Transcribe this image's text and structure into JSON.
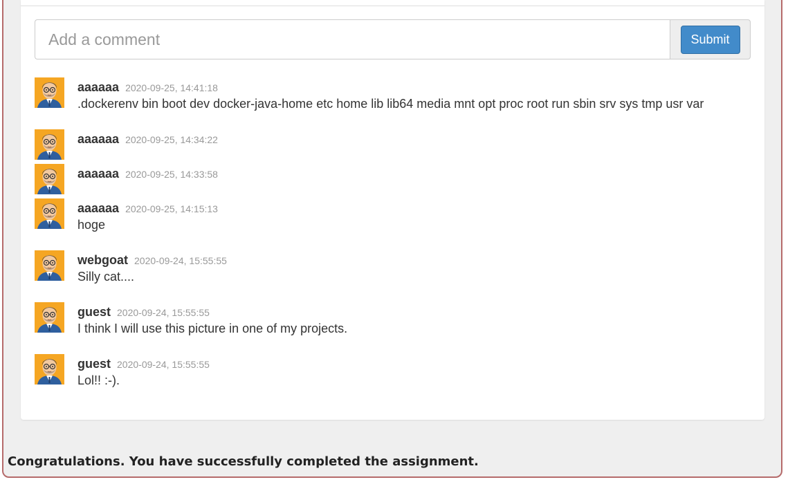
{
  "comment_form": {
    "placeholder": "Add a comment",
    "submit_label": "Submit"
  },
  "comments": [
    {
      "user": "aaaaaa",
      "time": "2020-09-25, 14:41:18",
      "text": ".dockerenv bin boot dev docker-java-home etc home lib lib64 media mnt opt proc root run sbin srv sys tmp usr var"
    },
    {
      "user": "aaaaaa",
      "time": "2020-09-25, 14:34:22",
      "text": ""
    },
    {
      "user": "aaaaaa",
      "time": "2020-09-25, 14:33:58",
      "text": ""
    },
    {
      "user": "aaaaaa",
      "time": "2020-09-25, 14:15:13",
      "text": "hoge"
    },
    {
      "user": "webgoat",
      "time": "2020-09-24, 15:55:55",
      "text": "Silly cat...."
    },
    {
      "user": "guest",
      "time": "2020-09-24, 15:55:55",
      "text": "I think I will use this picture in one of my projects."
    },
    {
      "user": "guest",
      "time": "2020-09-24, 15:55:55",
      "text": "Lol!! :-)."
    }
  ],
  "feedback": {
    "message": "Congratulations. You have successfully completed the assignment."
  },
  "colors": {
    "submit_button": "#428bca",
    "frame_border": "#b56a6a",
    "avatar_background": "#f5a623"
  },
  "icons": {
    "avatar": "cartoon-man-glasses-avatar-icon"
  }
}
